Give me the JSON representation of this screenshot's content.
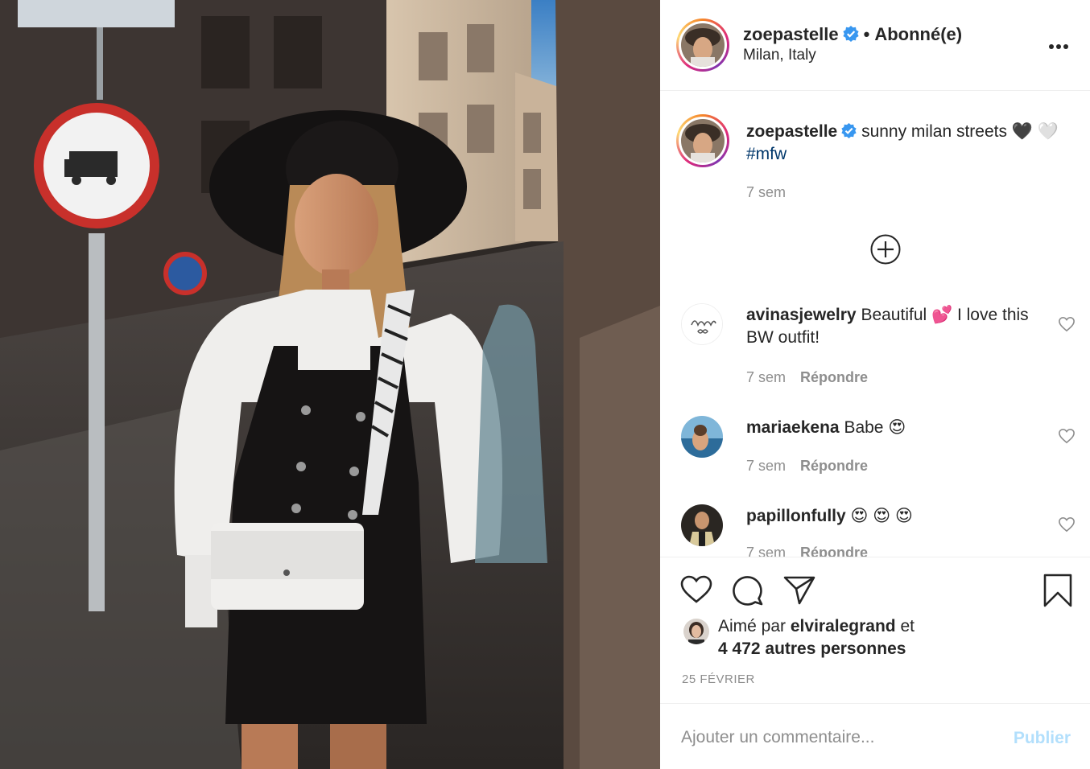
{
  "post": {
    "username": "zoepastelle",
    "follow_status": "Abonné(e)",
    "location": "Milan, Italy",
    "caption_text": "sunny milan streets 🖤",
    "caption_emoji2": "🤍",
    "caption_hashtag": "#mfw",
    "caption_time": "7 sem"
  },
  "comments": [
    {
      "username": "avinasjewelry",
      "text": "Beautiful 💕  I love this BW outfit!",
      "time": "7 sem",
      "reply": "Répondre"
    },
    {
      "username": "mariaekena",
      "text": "Babe 😍",
      "time": "7 sem",
      "reply": "Répondre"
    },
    {
      "username": "papillonfully",
      "text": "😍 😍 😍",
      "time": "7 sem",
      "reply": "Répondre"
    }
  ],
  "likes": {
    "prefix": "Aimé par",
    "liker": "elviralegrand",
    "connector": "et",
    "others": "4 472 autres personnes"
  },
  "date": "25 FÉVRIER",
  "add_comment": {
    "placeholder": "Ajouter un commentaire...",
    "publish": "Publier"
  },
  "colors": {
    "verified": "#3897f0",
    "hashtag": "#00376b",
    "publish_disabled": "#b2dffc",
    "muted": "#8e8e8e"
  },
  "icons": [
    "verified-badge-icon",
    "more-options-icon",
    "load-more-icon",
    "heart-icon",
    "comment-icon",
    "share-icon",
    "bookmark-icon"
  ]
}
